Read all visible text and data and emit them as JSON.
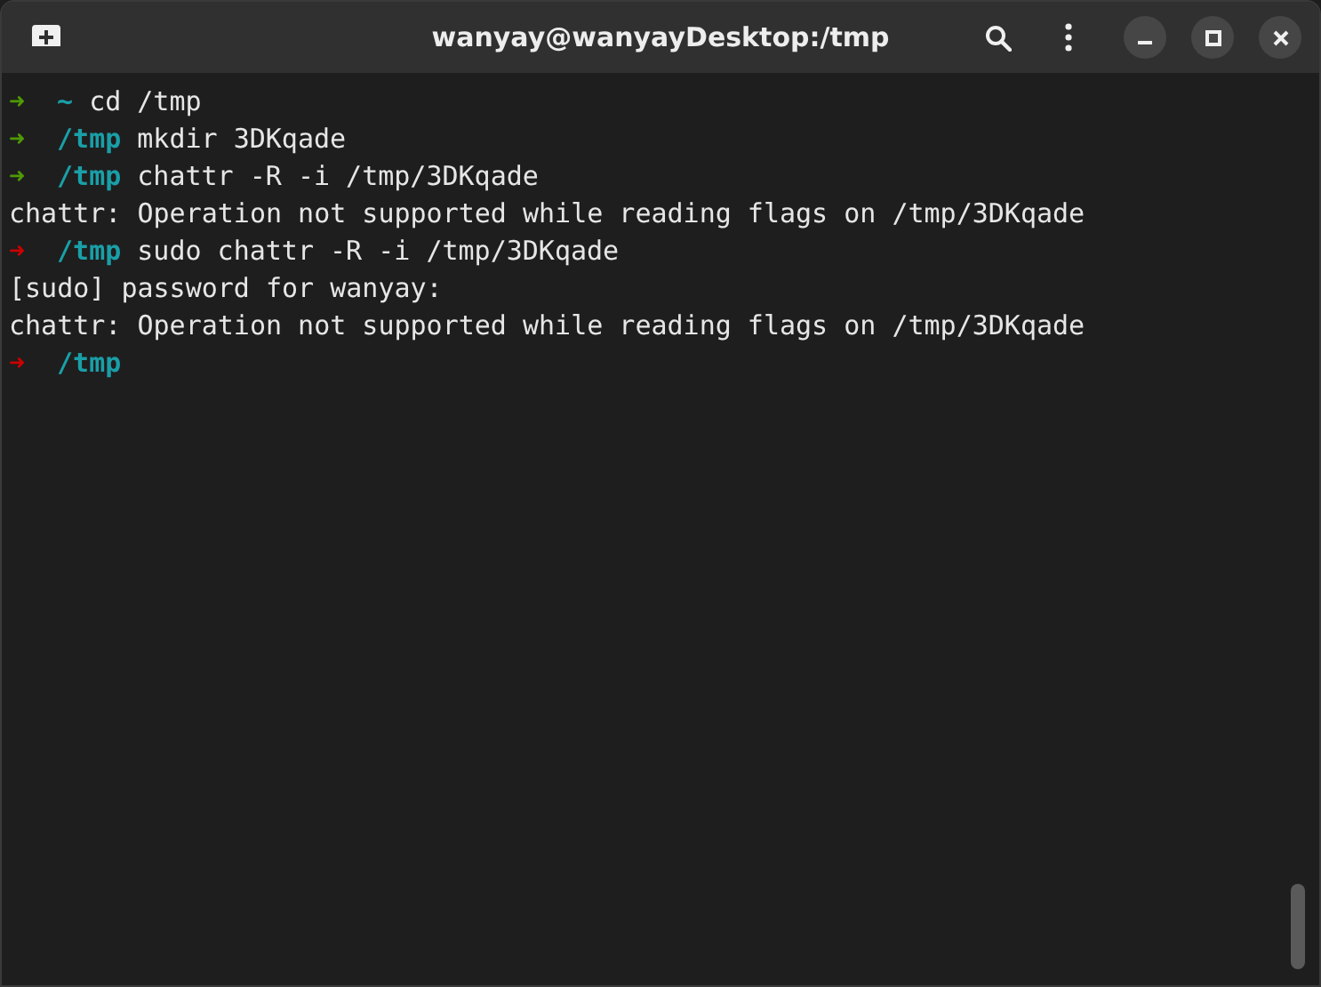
{
  "window": {
    "title": "wanyay@wanyayDesktop:/tmp"
  },
  "terminal": {
    "lines": [
      {
        "kind": "prompt",
        "success": true,
        "symbol": "➜",
        "dir": "~",
        "command": "cd /tmp"
      },
      {
        "kind": "prompt",
        "success": true,
        "symbol": "➜",
        "dir": "/tmp",
        "command": "mkdir 3DKqade"
      },
      {
        "kind": "prompt",
        "success": true,
        "symbol": "➜",
        "dir": "/tmp",
        "command": "chattr -R -i /tmp/3DKqade"
      },
      {
        "kind": "output",
        "text": "chattr: Operation not supported while reading flags on /tmp/3DKqade"
      },
      {
        "kind": "prompt",
        "success": false,
        "symbol": "➜",
        "dir": "/tmp",
        "command": "sudo chattr -R -i /tmp/3DKqade"
      },
      {
        "kind": "output",
        "text": "[sudo] password for wanyay:"
      },
      {
        "kind": "output",
        "text": "chattr: Operation not supported while reading flags on /tmp/3DKqade"
      },
      {
        "kind": "prompt",
        "success": false,
        "symbol": "➜",
        "dir": "/tmp"
      }
    ]
  }
}
